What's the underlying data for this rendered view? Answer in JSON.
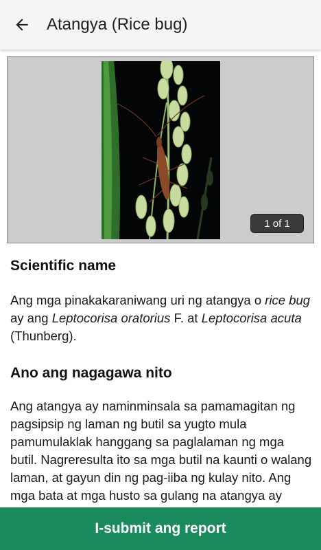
{
  "header": {
    "title": "Atangya (Rice bug)",
    "back_icon": "arrow-left-icon"
  },
  "gallery": {
    "counter": "1 of 1",
    "image_subject": "rice bug on rice panicle"
  },
  "sections": [
    {
      "title": "Scientific name",
      "parts": [
        {
          "t": "Ang mga pinakakaraniwang uri ng atangya o ",
          "i": false
        },
        {
          "t": "rice bug",
          "i": true
        },
        {
          "t": " ay ang ",
          "i": false
        },
        {
          "t": "Leptocorisa oratorius",
          "i": true
        },
        {
          "t": " F. at ",
          "i": false
        },
        {
          "t": "Leptocorisa acuta",
          "i": true
        },
        {
          "t": " (Thunberg).",
          "i": false
        }
      ]
    },
    {
      "title": "Ano ang nagagawa nito",
      "body": "Ang atangya ay naminminsala sa pamamagitan ng pagsipsip ng laman ng butil sa yugto mula pamumulaklak hanggang sa paglalaman ng mga butil. Nagreresulta ito sa mga butil na kaunti o walang laman, at gayun din ng pag-iiba ng kulay nito. Ang mga bata at mga husto sa gulang na atangya ay parehong nagsisipsip sa"
    }
  ],
  "footer": {
    "submit_label": "I-submit ang report"
  },
  "colors": {
    "appbar_bg": "#f5f5f5",
    "submit_bg": "#1b8a5c",
    "image_frame_bg": "#cccccc"
  }
}
